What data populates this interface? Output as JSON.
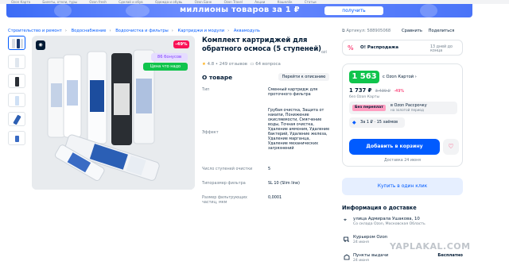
{
  "topnav": {
    "items": [
      "Ozon Карта",
      "Билеты, отели, туры",
      "Ozon fresh",
      "Сделай и обув",
      "Одежда и обувь",
      "Ozon Банк",
      "Ozon Travel",
      "Акции",
      "Кошелёк",
      "Статьи"
    ]
  },
  "banner": {
    "title": "миллионы товаров за 1 ₽",
    "button": "получить"
  },
  "breadcrumbs": [
    "Строительство и ремонт",
    "Водоснабжение",
    "Водоочистка и фильтры",
    "Картриджи и модули",
    "Аквамодуль"
  ],
  "product": {
    "title": "Комплект картриджей для обратного осмоса (5 ступеней)",
    "rating": "4.8",
    "reviews": "249 отзывов",
    "questions": "64 вопроса",
    "discount": "-49%",
    "bonus": "86 бонусов",
    "good_price": "Цена что надо",
    "sku": "Артикул: 588905068",
    "about_title": "О товаре",
    "to_desc": "Перейти к описанию"
  },
  "specs": [
    {
      "key": "Тип",
      "value": "Сменный картридж для проточного фильтра"
    },
    {
      "key": "Эффект",
      "value": "Грубая очистка, Защита от накипи, Понижение окисляемости, Смягчение воды, Точная очистка, Удаление аммония, Удаление бактерий, Удаление железа, Удаление марганца, Удаление механических загрязнений"
    },
    {
      "key": "Число ступеней очистки",
      "value": "5"
    },
    {
      "key": "Типоразмер фильтра",
      "value": "SL 10 (Slim line)"
    },
    {
      "key": "Размер фильтрующих частиц, мкм",
      "value": "0,0001"
    }
  ],
  "actions": [
    "Сравнить",
    "Поделиться"
  ],
  "promo": {
    "title": "О! Распродажа",
    "days": "13 дней до конца"
  },
  "price": {
    "card_price": "1 563 ₽",
    "card_label": "с Ozon Картой",
    "price": "1 737 ₽",
    "old_price": "3 439 ₽",
    "percent": "-49%",
    "no_card": "без Ozon Карты",
    "installment_badge": "Без переплат",
    "installment_title": "в Ozon Рассрочку",
    "installment_sub": "на золотой период",
    "split": "За 1 ₽ · 15 заёмов",
    "add_to_cart": "Добавить в корзину",
    "delivery_date": "Доставка 24 июня"
  },
  "one_click": "Купить в один клик",
  "delivery": {
    "title": "Информация о доставке",
    "address": "улица Адмирала Ушакова, 10",
    "region": "Со склада Ozon, Московская Область",
    "options": [
      {
        "title": "Курьером Ozon",
        "sub": "24 июня",
        "right": ""
      },
      {
        "title": "Пункты выдачи",
        "sub": "24 июня",
        "right": "Бесплатно"
      }
    ]
  },
  "watermark": "YAPLAKAL.COM",
  "colors": {
    "accent": "#005bff",
    "green": "#10c44c",
    "pink": "#f91155",
    "bonus": "#7f3bff"
  }
}
